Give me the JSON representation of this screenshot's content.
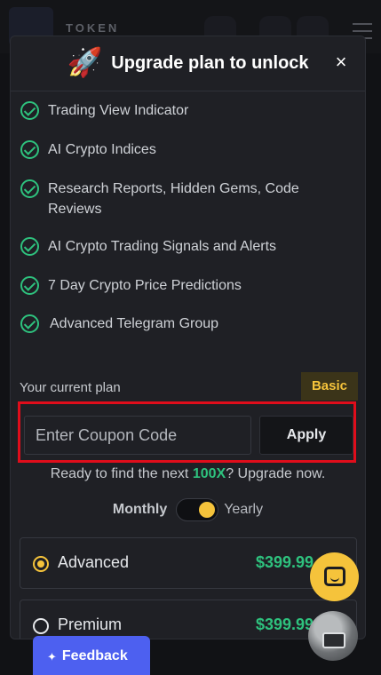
{
  "app": {
    "logo_text": "TOKEN"
  },
  "modal": {
    "title": "Upgrade plan to unlock",
    "close_label": "×",
    "features": [
      "Trading View Indicator",
      "AI Crypto Indices",
      "Research Reports, Hidden Gems, Code Reviews",
      "AI Crypto Trading Signals and Alerts",
      "7 Day Crypto Price Predictions",
      "Advanced Telegram Group"
    ],
    "current_plan": {
      "label": "Your current plan",
      "value": "Basic"
    },
    "coupon": {
      "placeholder": "Enter Coupon Code",
      "value": "",
      "apply_label": "Apply"
    },
    "tagline": {
      "before": "Ready to find the next ",
      "highlight": "100X",
      "after": "? Upgrade now."
    },
    "billing": {
      "monthly_label": "Monthly",
      "yearly_label": "Yearly",
      "selected": "Yearly"
    },
    "plans": [
      {
        "name": "Advanced",
        "price": "$399.99",
        "selected": true
      },
      {
        "name": "Premium",
        "price": "$399.99",
        "selected": false
      }
    ]
  },
  "feedback": {
    "label": "Feedback"
  },
  "colors": {
    "accent_yellow": "#f5c33b",
    "accent_green": "#2ec27e",
    "highlight_red": "#e00d1b",
    "feedback_blue": "#4d60f0"
  }
}
